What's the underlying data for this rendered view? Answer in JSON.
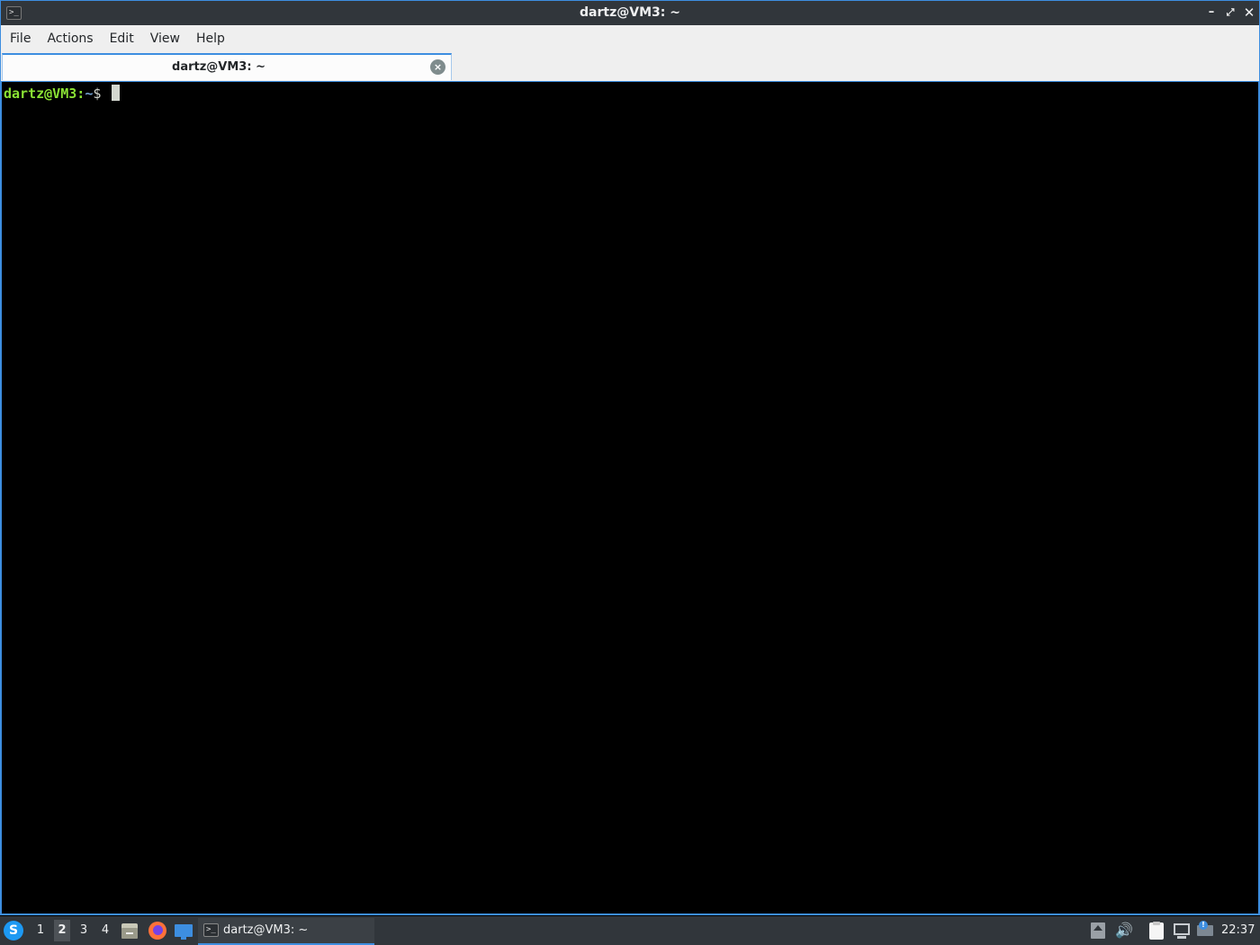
{
  "window": {
    "title": "dartz@VM3: ~",
    "app_icon": "terminal-icon",
    "controls": {
      "minimize": "–",
      "maximize": "⤢",
      "close": "✕"
    }
  },
  "menubar": {
    "items": [
      "File",
      "Actions",
      "Edit",
      "View",
      "Help"
    ]
  },
  "tabs": [
    {
      "label": "dartz@VM3: ~",
      "close_icon": "close-circle-icon",
      "close_glyph": "×"
    }
  ],
  "terminal": {
    "prompt_user_host": "dartz@VM3",
    "prompt_colon": ":",
    "prompt_path": "~",
    "prompt_sign": "$",
    "colors": {
      "user": "#8ae234",
      "path": "#729fcf",
      "background": "#000000"
    }
  },
  "taskbar": {
    "menu_icon": "lxqt-menu-icon",
    "menu_glyph": "S",
    "desktops": [
      "1",
      "2",
      "3",
      "4"
    ],
    "active_desktop": "2",
    "quicklaunch": [
      "file-manager-icon",
      "firefox-icon",
      "show-desktop-icon"
    ],
    "tasks": [
      {
        "label": "dartz@VM3: ~",
        "icon": "terminal-icon"
      }
    ],
    "tray": [
      "tray-arrow-icon",
      "volume-icon",
      "clipboard-icon",
      "network-icon",
      "notification-icon"
    ],
    "volume_glyph": "🔊",
    "notification_glyph": "!",
    "clock": "22:37"
  },
  "accent_color": "#3d8ee0"
}
